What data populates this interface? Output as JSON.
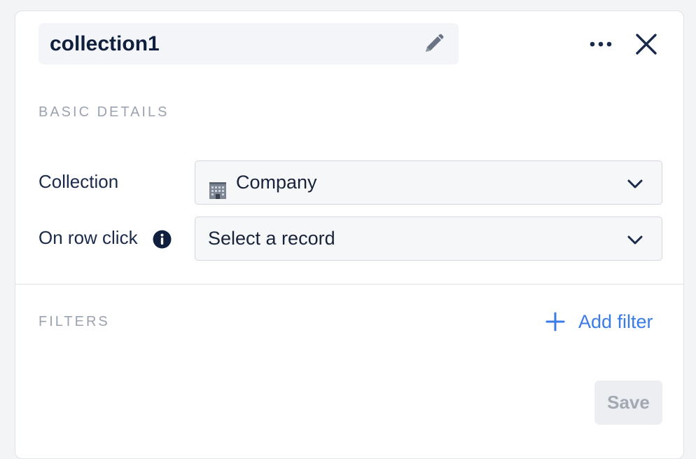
{
  "header": {
    "title": "collection1",
    "edit_icon": "pencil-icon",
    "more_icon": "more-horizontal-icon",
    "close_icon": "close-icon"
  },
  "basic_details": {
    "section_title": "BASIC DETAILS",
    "collection": {
      "label": "Collection",
      "value": "Company",
      "value_icon": "building-icon"
    },
    "row_click": {
      "label": "On row click",
      "info_icon": "info-icon",
      "value": "Select a record"
    }
  },
  "filters": {
    "section_title": "FILTERS",
    "add_label": "Add filter",
    "add_icon": "plus-icon"
  },
  "footer": {
    "save_label": "Save"
  },
  "colors": {
    "accent": "#3a7be8",
    "text_dark": "#0f1f3d",
    "muted": "#9aa3af",
    "disabled_bg": "#eceef1",
    "disabled_text": "#a3a9b3"
  }
}
